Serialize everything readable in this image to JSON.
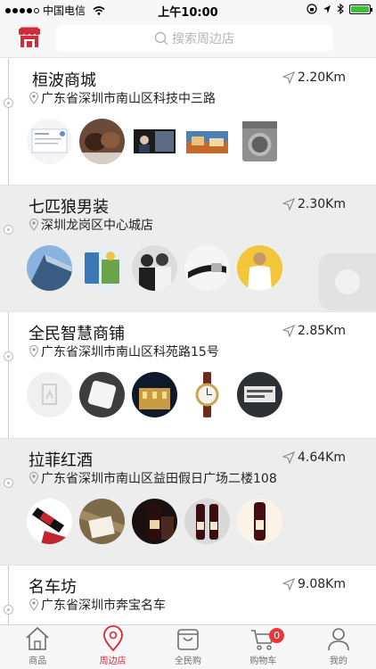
{
  "status_bar": {
    "carrier": "中国电信",
    "time": "上午10:00"
  },
  "header": {
    "search_placeholder": "搜索周边店"
  },
  "stores": [
    {
      "name": "桓波商城",
      "distance": "2.20Km",
      "address": "广东省深圳市南山区科技中三路",
      "thumbnails": [
        "product-screenshot",
        "handbags",
        "video-conference",
        "shopfront",
        "washing-machine"
      ]
    },
    {
      "name": "七匹狼男装",
      "distance": "2.30Km",
      "address": "深圳龙岗区中心城店",
      "thumbnails": [
        "building",
        "poster",
        "couple-photo",
        "belt",
        "man-in-white-shirt"
      ]
    },
    {
      "name": "全民智慧商铺",
      "distance": "2.85Km",
      "address": "广东省深圳市南山区科苑路15号",
      "thumbnails": [
        "placeholder",
        "router",
        "night-building",
        "watch",
        "parking-sign"
      ]
    },
    {
      "name": "拉菲红酒",
      "distance": "4.64Km",
      "address": "广东省深圳市南山区益田假日广场二楼108",
      "thumbnails": [
        "wine-bottle-lying",
        "wine-box",
        "wine-bottle-dark",
        "two-wine-bottles",
        "wine-bottle"
      ]
    },
    {
      "name": "名车坊",
      "distance": "9.08Km",
      "address": "广东省深圳市奔宝名车",
      "thumbnails": []
    }
  ],
  "tabbar": {
    "items": [
      {
        "label": "商品",
        "icon": "home-icon"
      },
      {
        "label": "周边店",
        "icon": "location-pin-icon"
      },
      {
        "label": "全民购",
        "icon": "shopping-bag-icon"
      },
      {
        "label": "购物车",
        "icon": "cart-icon",
        "badge": "0"
      },
      {
        "label": "我的",
        "icon": "user-icon"
      }
    ],
    "active_index": 1
  },
  "colors": {
    "accent": "#d22b3b",
    "row_alt": "#ededed"
  }
}
